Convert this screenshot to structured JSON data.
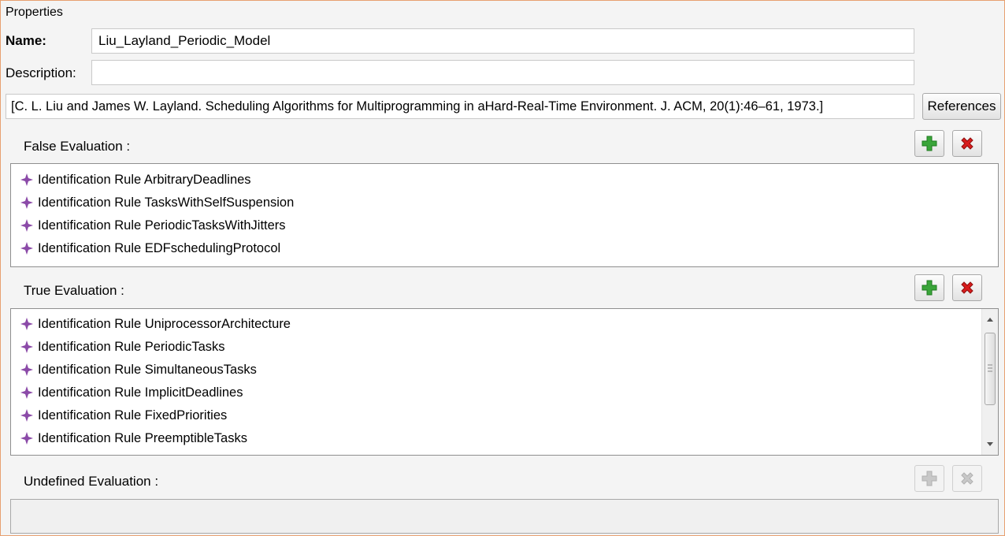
{
  "panel": {
    "title": "Properties",
    "name_label": "Name:",
    "name_value": "Liu_Layland_Periodic_Model",
    "description_label": "Description:",
    "description_value": "",
    "reference_text": "[C. L. Liu and James W. Layland. Scheduling Algorithms for Multiprogramming in aHard-Real-Time Environment. J. ACM, 20(1):46–61, 1973.]",
    "references_button": "References"
  },
  "false_eval": {
    "label": "False Evaluation :",
    "items": [
      "Identification Rule ArbitraryDeadlines",
      "Identification Rule TasksWithSelfSuspension",
      "Identification Rule PeriodicTasksWithJitters",
      "Identification Rule EDFschedulingProtocol"
    ]
  },
  "true_eval": {
    "label": "True Evaluation :",
    "items": [
      "Identification Rule UniprocessorArchitecture",
      "Identification Rule PeriodicTasks",
      "Identification Rule SimultaneousTasks",
      "Identification Rule ImplicitDeadlines",
      "Identification Rule FixedPriorities",
      "Identification Rule PreemptibleTasks"
    ]
  },
  "undefined_eval": {
    "label": "Undefined Evaluation :",
    "items": []
  },
  "colors": {
    "add_green": "#3aa53a",
    "remove_red": "#d81c1c",
    "rule_icon_purple": "#8b4aa8",
    "panel_border": "#e8a070"
  },
  "icons": {
    "add": "plus-icon",
    "remove": "x-icon",
    "rule": "rule-diamond-icon"
  }
}
